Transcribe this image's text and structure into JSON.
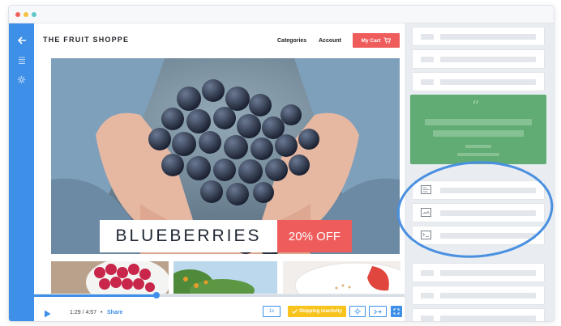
{
  "store": {
    "brand": "THE FRUIT SHOPPE",
    "nav": [
      "Categories",
      "Account"
    ],
    "cart_label": "My Cart",
    "hero_title": "BLUEBERRIES",
    "hero_badge": "20% OFF"
  },
  "player": {
    "time": "1:29 / 4:57",
    "separator": "•",
    "share": "Share",
    "speed": "1x",
    "skip_label": "Skipping inactivity",
    "progress": 0.33
  },
  "icons": {
    "rail": [
      "arrow-left-icon",
      "list-icon",
      "gear-icon"
    ],
    "cart": "cart-icon",
    "play": "play-icon",
    "skip": "checkmark-icon",
    "expand": "expand-icon"
  },
  "colors": {
    "accent": "#3d8fe8",
    "sale": "#ef5c5c",
    "skip": "#f7c31c",
    "quote_card": "#61ab74"
  }
}
